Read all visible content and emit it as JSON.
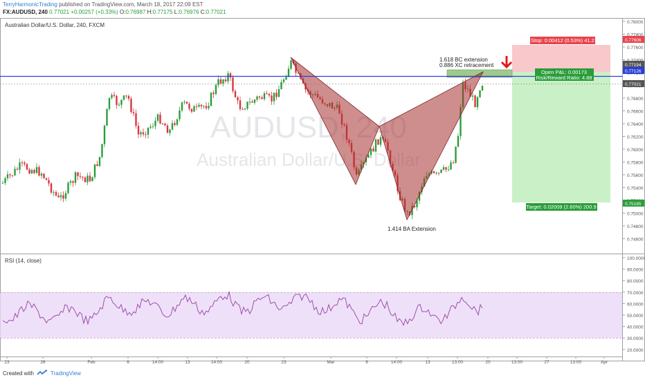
{
  "header": {
    "author": "TerryHarmonicTrading",
    "published_text": "published on TradingView.com, March 18, 2017 22:09 EST",
    "symbol": "FX:AUDUSD, 240",
    "open_label": "O:",
    "open": "0.76987",
    "high_label": "H:",
    "high": "0.77175",
    "low_label": "L:",
    "low": "0.76976",
    "close_label": "C:",
    "close": "0.77021",
    "last": "0.77021",
    "change": "+0.00257 (+0.33%)"
  },
  "main_pane": {
    "title": "Australian Dollar/U.S. Dollar, 240, FXCM",
    "watermark_symbol": "AUDUSD, 240",
    "watermark_name": "Australian Dollar/U.S. Dollar",
    "price_axis_ticks": [
      "0.78000",
      "0.77800",
      "0.77600",
      "0.77400",
      "0.77200",
      "0.77000",
      "0.76800",
      "0.76600",
      "0.76400",
      "0.76200",
      "0.76000",
      "0.75800",
      "0.75600",
      "0.75400",
      "0.75200",
      "0.75000",
      "0.74800",
      "0.74600"
    ],
    "price_tags": [
      {
        "text": "0.77606",
        "color": "#e8434c"
      },
      {
        "text": "0.77194",
        "color": "#555555"
      },
      {
        "text": "0.77126",
        "color": "#2a3fd6"
      },
      {
        "text": "0.77021",
        "color": "#555555"
      },
      {
        "text": "0.75185",
        "color": "#2a9d3a"
      }
    ],
    "annotations": {
      "bc_extension": "1.618 BC extension",
      "xc_retracement": "0.886 XC retracement",
      "ba_extension": "1.414 BA Extension"
    },
    "position": {
      "stop_label": "Stop: 0.00412 (0.53%) 41.2",
      "open_pnl": "Open P&L: 0.00173",
      "risk_reward": "Risk/Reward Ratio: 4.88",
      "target_label": "Target: 0.02009 (2.60%) 200.9"
    }
  },
  "rsi_pane": {
    "title": "RSI (14, close)",
    "axis_ticks": [
      "100.0000",
      "90.0000",
      "80.0000",
      "70.0000",
      "60.0000",
      "50.0000",
      "40.0000",
      "30.0000",
      "20.0000"
    ]
  },
  "time_axis": [
    "23",
    "26",
    "Feb",
    "6",
    "14:00",
    "13",
    "14:00",
    "20",
    "23",
    "Mar",
    "6",
    "14:00",
    "13",
    "13:00",
    "20",
    "13:00",
    "27",
    "13:00",
    "Apr"
  ],
  "footer": {
    "created_with": "Created with",
    "brand": "TradingView"
  },
  "colors": {
    "up_candle": "#2a9d3a",
    "down_candle": "#d9353f",
    "pattern_fill": "#a83232",
    "stop_zone": "#f8c8ca",
    "target_zone": "#c9f0c6",
    "entry_line": "#2a3fd6",
    "rsi_line": "#9c4fa8",
    "rsi_band": "#ead6f7",
    "arrow": "#e01b1b"
  }
}
